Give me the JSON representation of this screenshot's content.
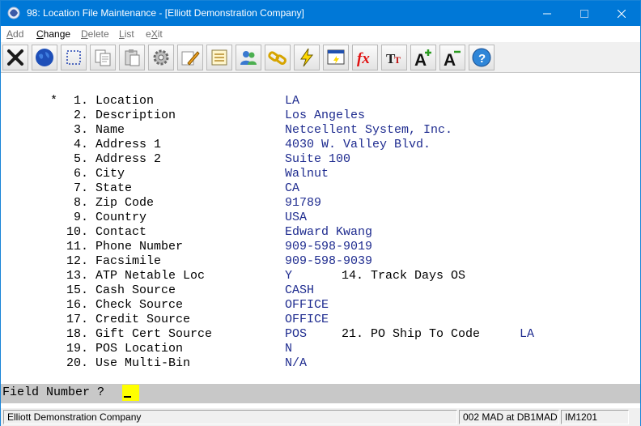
{
  "window": {
    "title": "98: Location File Maintenance - [Elliott Demonstration Company]",
    "minimize_icon": "minimize-icon",
    "maximize_icon": "maximize-icon",
    "close_icon": "close-icon"
  },
  "menu": {
    "add": {
      "u": "A",
      "rest": "dd"
    },
    "change": {
      "u": "C",
      "rest": "hange"
    },
    "delete": {
      "u": "D",
      "rest": "elete"
    },
    "list": {
      "u": "L",
      "rest": "ist"
    },
    "exit": {
      "pre": "e",
      "u": "X",
      "rest": "it"
    }
  },
  "toolbar": [
    {
      "name": "exit-icon"
    },
    {
      "name": "globe-icon"
    },
    {
      "name": "select-icon"
    },
    {
      "name": "copy-icon"
    },
    {
      "name": "paste-icon"
    },
    {
      "name": "settings-icon"
    },
    {
      "name": "edit-icon"
    },
    {
      "name": "notes-icon"
    },
    {
      "name": "users-icon"
    },
    {
      "name": "link-icon"
    },
    {
      "name": "lightning-icon"
    },
    {
      "name": "screen-icon"
    },
    {
      "name": "function-icon"
    },
    {
      "name": "text-size-icon"
    },
    {
      "name": "font-increase-icon"
    },
    {
      "name": "font-decrease-icon"
    },
    {
      "name": "help-icon"
    }
  ],
  "fields": {
    "marker": "*",
    "rows": [
      {
        "label": " 1. Location",
        "value": "LA"
      },
      {
        "label": " 2. Description",
        "value": "Los Angeles"
      },
      {
        "label": " 3. Name",
        "value": "Netcellent System, Inc."
      },
      {
        "label": " 4. Address 1",
        "value": "4030 W. Valley Blvd."
      },
      {
        "label": " 5. Address 2",
        "value": "Suite 100"
      },
      {
        "label": " 6. City",
        "value": "Walnut"
      },
      {
        "label": " 7. State",
        "value": "CA"
      },
      {
        "label": " 8. Zip Code",
        "value": "91789"
      },
      {
        "label": " 9. Country",
        "value": "USA"
      },
      {
        "label": "10. Contact",
        "value": "Edward Kwang"
      },
      {
        "label": "11. Phone Number",
        "value": "909-598-9019"
      },
      {
        "label": "12. Facsimile",
        "value": "909-598-9039"
      },
      {
        "label": "13. ATP Netable Loc",
        "value": "Y",
        "label2": "14. Track Days OS",
        "value2": ""
      },
      {
        "label": "15. Cash Source",
        "value": "CASH"
      },
      {
        "label": "16. Check Source",
        "value": "OFFICE"
      },
      {
        "label": "17. Credit Source",
        "value": "OFFICE"
      },
      {
        "label": "18. Gift Cert Source",
        "value": "POS",
        "label2": "21. PO Ship To Code",
        "value2": "LA"
      },
      {
        "label": "19. POS Location",
        "value": "N"
      },
      {
        "label": "20. Use Multi-Bin",
        "value": "N/A"
      }
    ]
  },
  "prompt": {
    "label": "Field Number ?",
    "value": ""
  },
  "status": {
    "company": "Elliott Demonstration Company",
    "session": "002 MAD at DB1MAD",
    "code": "IM1201"
  },
  "colors": {
    "titlebar": "#0078d7",
    "value_text": "#1e2b8f",
    "prompt_input": "#ffff00"
  }
}
